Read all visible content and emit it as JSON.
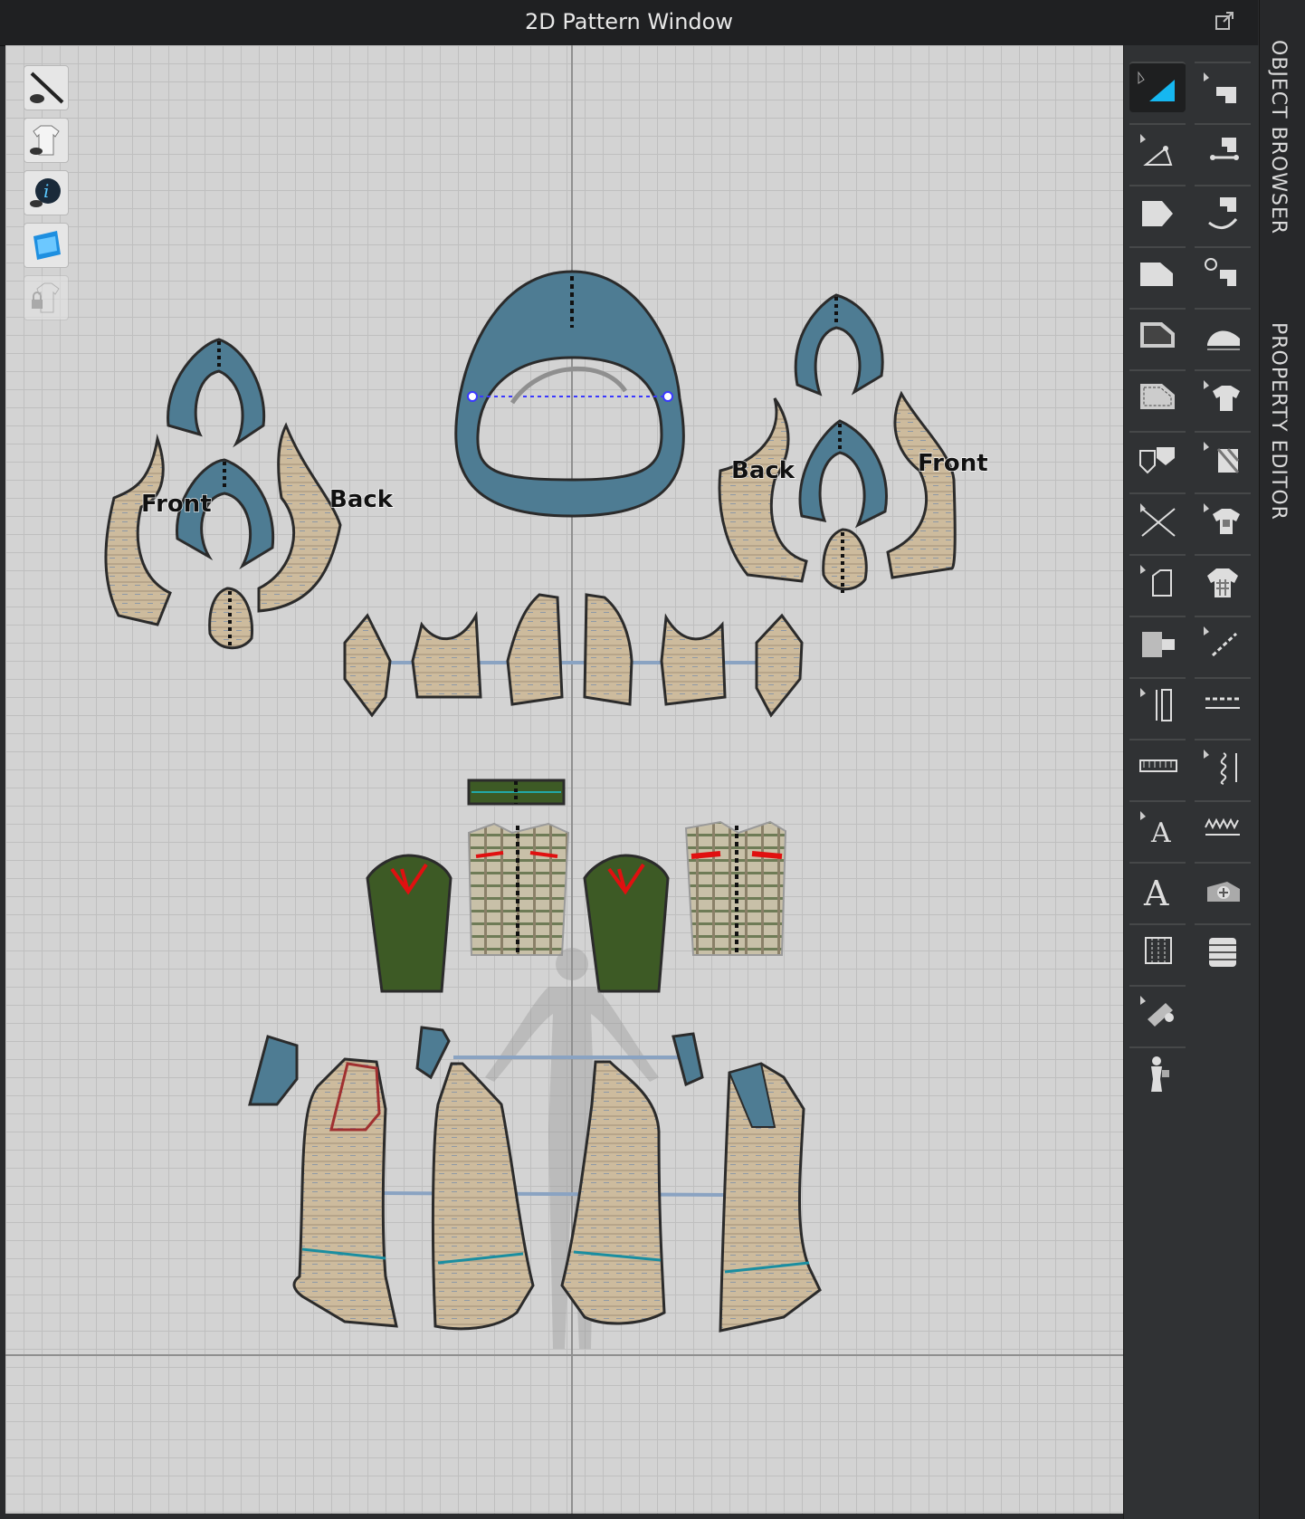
{
  "window": {
    "title": "2D Pattern Window"
  },
  "pattern_labels": {
    "left_front": "Front",
    "left_back": "Back",
    "right_back": "Back",
    "right_front": "Front"
  },
  "side_tabs": {
    "object_browser": "OBJECT BROWSER",
    "property_editor": "PROPERTY EDITOR"
  },
  "colors": {
    "teal_fabric": "#4e7c93",
    "tweed_fabric": "#cdbb9d",
    "green_fabric": "#3d5a25",
    "seam_red": "#e01010",
    "canvas": "#d3d3d3",
    "panel": "#303234"
  },
  "left_toolbar": [
    {
      "icon": "show-baseline-icon"
    },
    {
      "icon": "show-pattern-icon"
    },
    {
      "icon": "show-info-icon"
    },
    {
      "icon": "show-texture-icon"
    },
    {
      "icon": "lock-pattern-icon"
    }
  ],
  "right_toolbar_col1": [
    "transform-pattern-icon",
    "edit-point-line-icon",
    "polygon-icon",
    "rectangle-icon",
    "internal-polygon-icon",
    "internal-rectangle-icon",
    "dart-icon",
    "cut-line-icon",
    "fold-icon",
    "sewing-tape-icon",
    "ruler-icon",
    "tape-measure-icon",
    "text-tool-icon",
    "text-style-icon",
    "grid-icon",
    "pins-tool-icon",
    "avatar-measure-icon"
  ],
  "right_toolbar_col2": [
    "segment-sewing-icon",
    "free-sewing-icon",
    "curved-sewing-icon",
    "check-sewing-icon",
    "steam-icon",
    "fit-garment-icon",
    "texture-edit-icon",
    "graphic-icon",
    "check-pattern-icon",
    "topstitch-icon",
    "stitch-line-icon",
    "elastic-icon",
    "zigzag-stitch-icon",
    "button-icon",
    "puckering-icon"
  ]
}
